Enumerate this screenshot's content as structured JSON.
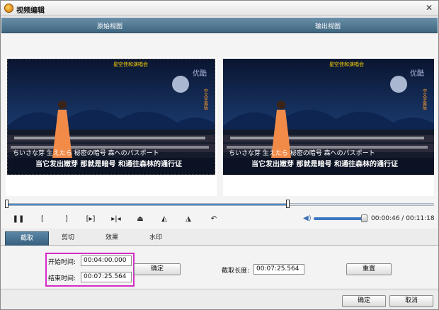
{
  "window": {
    "title": "视频编辑",
    "close_symbol": "✕"
  },
  "views": {
    "original_label": "原始视图",
    "output_label": "输出视图"
  },
  "player": {
    "current_time": "00:00:46",
    "separator": " / ",
    "total_time": "00:11:18",
    "progress_fraction": 0.66,
    "volume_fraction": 0.88
  },
  "controls": [
    {
      "name": "pause-button",
      "glyph": "❚❚"
    },
    {
      "name": "mark-in-button",
      "glyph": "["
    },
    {
      "name": "mark-out-button",
      "glyph": "]"
    },
    {
      "name": "play-segment-button",
      "glyph": "[▸]"
    },
    {
      "name": "step-button",
      "glyph": "▸|◂"
    },
    {
      "name": "flip-vertical-button",
      "glyph": "⏏"
    },
    {
      "name": "rotate-left-button",
      "glyph": "◭"
    },
    {
      "name": "rotate-right-button",
      "glyph": "◮"
    },
    {
      "name": "undo-button",
      "glyph": "↶"
    }
  ],
  "tabs": [
    "截取",
    "剪切",
    "效果",
    "水印"
  ],
  "trim": {
    "start_label": "开始时间:",
    "start_value": "00:04:00.000",
    "end_label": "结束时间:",
    "end_value": "00:07:25.564",
    "confirm_label": "确定",
    "length_label": "截取长度:",
    "length_value": "00:07:25.564",
    "reset_label": "重置"
  },
  "footer": {
    "ok_label": "确定",
    "cancel_label": "取消"
  },
  "video_overlay": {
    "title_text": "星空佳和演唱会",
    "subtitle_jp": "ちいさな芽 生えたら 秘密の暗号 森へのパスポート",
    "subtitle_cn": "当它发出嫩芽 那就是暗号 和通往森林的通行证",
    "side_text": "中文字幕版",
    "logo": "优酷"
  },
  "colors": {
    "accent_bar": "#3f6680",
    "highlight": "#d62bc6",
    "volume": "#3b78c0"
  }
}
